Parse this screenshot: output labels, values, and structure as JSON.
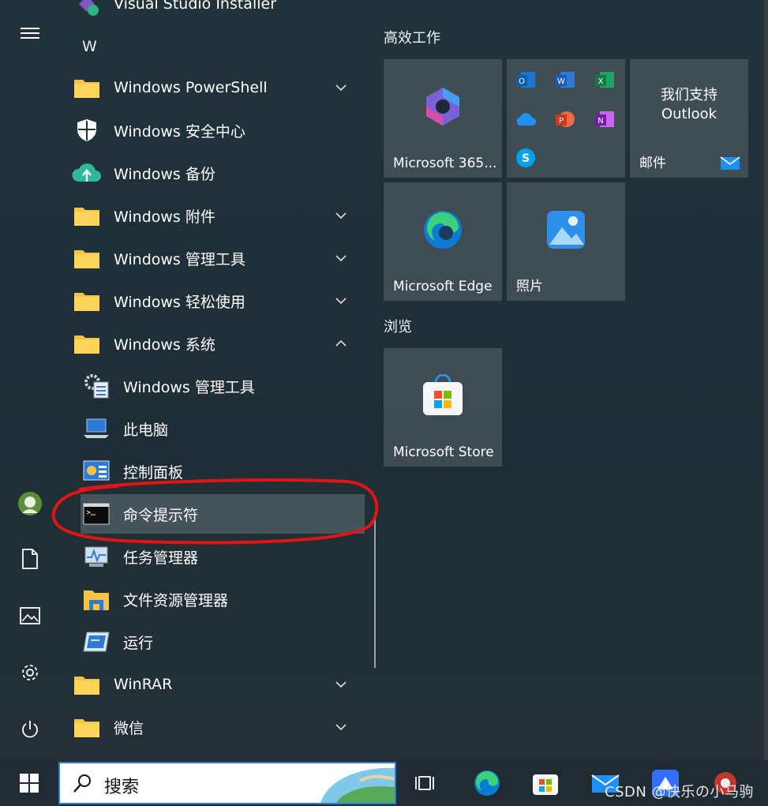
{
  "top_partial_item": {
    "label": "Visual Studio Installer"
  },
  "section_letter": "W",
  "apps": [
    {
      "label": "Windows PowerShell",
      "icon": "folder-icon",
      "expand": "chevron-down"
    },
    {
      "label": "Windows 安全中心",
      "icon": "shield-icon"
    },
    {
      "label": "Windows 备份",
      "icon": "backup-cloud-icon"
    },
    {
      "label": "Windows 附件",
      "icon": "folder-icon",
      "expand": "chevron-down"
    },
    {
      "label": "Windows 管理工具",
      "icon": "folder-icon",
      "expand": "chevron-down"
    },
    {
      "label": "Windows 轻松使用",
      "icon": "folder-icon",
      "expand": "chevron-down"
    },
    {
      "label": "Windows 系统",
      "icon": "folder-icon",
      "expand": "chevron-up"
    }
  ],
  "system_subitems": [
    {
      "label": "Windows 管理工具",
      "icon": "admin-tools-icon"
    },
    {
      "label": "此电脑",
      "icon": "this-pc-icon"
    },
    {
      "label": "控制面板",
      "icon": "control-panel-icon"
    },
    {
      "label": "命令提示符",
      "icon": "cmd-icon",
      "highlighted": true
    },
    {
      "label": "任务管理器",
      "icon": "task-manager-icon"
    },
    {
      "label": "文件资源管理器",
      "icon": "file-explorer-icon"
    },
    {
      "label": "运行",
      "icon": "run-icon"
    }
  ],
  "more_apps": [
    {
      "label": "WinRAR",
      "icon": "folder-icon",
      "expand": "chevron-down"
    },
    {
      "label": "微信",
      "icon": "folder-icon",
      "expand": "chevron-down"
    }
  ],
  "rail": [
    "hamburger-icon",
    "user-avatar",
    "documents-icon",
    "pictures-icon",
    "settings-icon",
    "power-icon"
  ],
  "groups": {
    "productivity": "高效工作",
    "browse": "浏览"
  },
  "tiles": {
    "m365": "Microsoft 365...",
    "outlook_line1": "我们支持",
    "outlook_line2": "Outlook",
    "mail": "邮件",
    "edge": "Microsoft Edge",
    "photos": "照片",
    "store": "Microsoft Store"
  },
  "taskbar": {
    "search_placeholder": "搜索"
  },
  "watermark": "CSDN @快乐の小马驹",
  "colors": {
    "accent_blue": "#2f7ad6",
    "folder_yellow": "#f6c344",
    "annotation_red": "#e01616"
  }
}
